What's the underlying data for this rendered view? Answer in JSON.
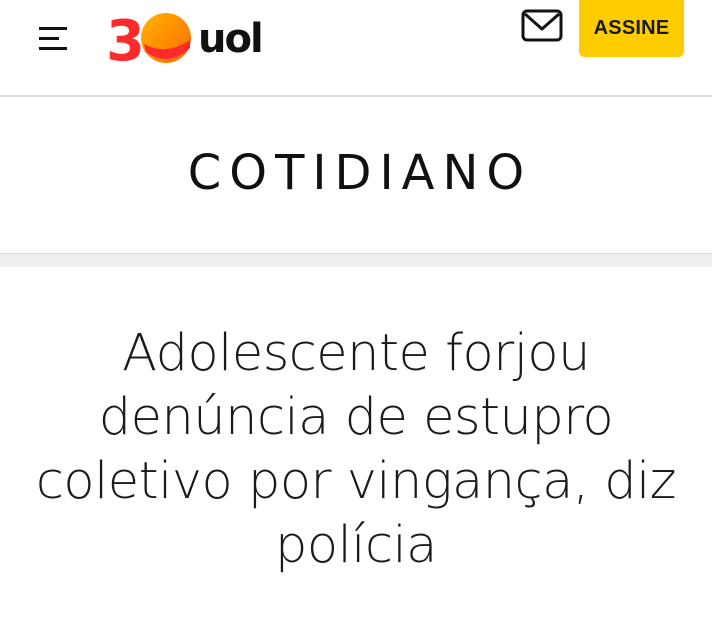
{
  "header": {
    "logo_anniversary": "30",
    "logo_brand": "uol",
    "subscribe_label": "ASSINE",
    "brand_yellow": "#ffcc00",
    "icons": [
      "hamburger-menu-icon",
      "mail-icon"
    ]
  },
  "section": {
    "title": "COTIDIANO"
  },
  "article": {
    "headline": "Adolescente forjou denúncia de estupro coletivo por vingança, diz polícia"
  }
}
